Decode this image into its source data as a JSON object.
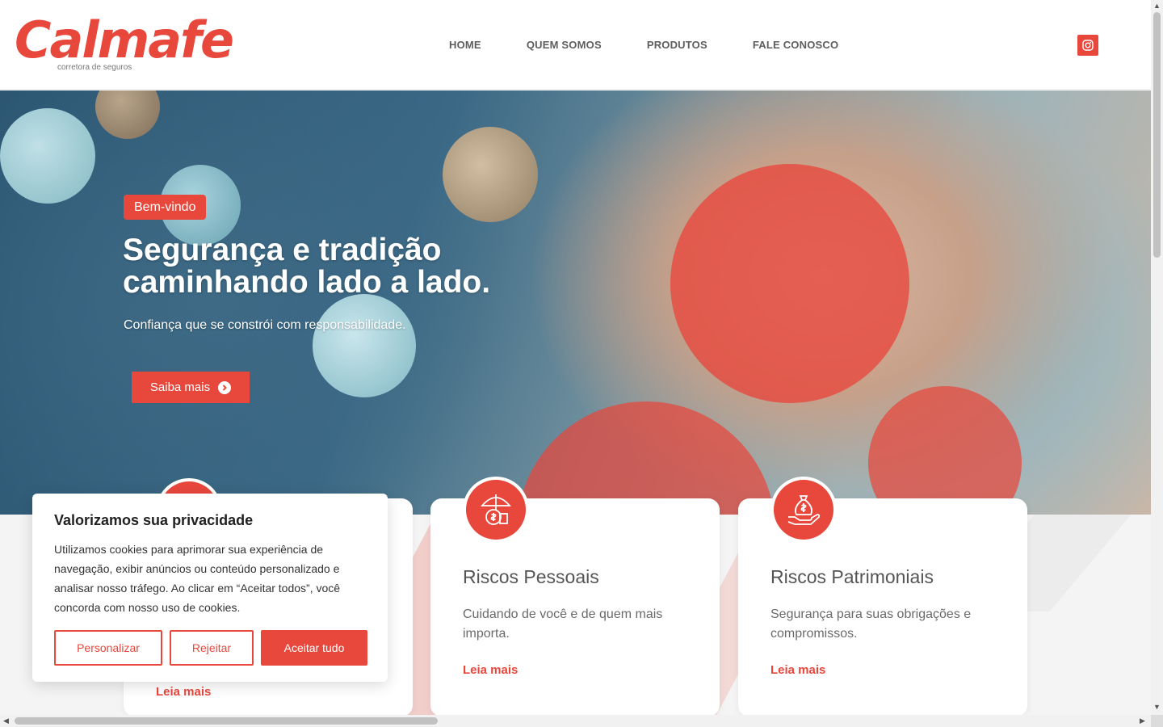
{
  "header": {
    "logo_text": "Calmafe",
    "logo_sub": "corretora de seguros",
    "nav": [
      "HOME",
      "QUEM SOMOS",
      "PRODUTOS",
      "FALE CONOSCO"
    ],
    "social_icon": "instagram-icon"
  },
  "hero": {
    "badge": "Bem-vindo",
    "title": "Segurança e tradição caminhando lado a lado.",
    "subtitle": "Confiança que se constrói com responsabilidade.",
    "cta": "Saiba mais"
  },
  "cards": [
    {
      "title": "Riscos Pessoais",
      "text": "Cuidando de você e de quem mais importa.",
      "link": "Leia mais",
      "icon": "umbrella-money-icon"
    },
    {
      "title": "Riscos Patrimoniais",
      "text": "Segurança para suas obrigações e compromissos.",
      "link": "Leia mais",
      "icon": "money-bag-hand-icon"
    }
  ],
  "hidden_card_link": "Leia mais",
  "cookie": {
    "title": "Valorizamos sua privacidade",
    "text": "Utilizamos cookies para aprimorar sua experiência de navegação, exibir anúncios ou conteúdo personalizado e analisar nosso tráfego. Ao clicar em “Aceitar todos”, você concorda com nosso uso de cookies.",
    "buttons": {
      "customize": "Personalizar",
      "reject": "Rejeitar",
      "accept": "Aceitar tudo"
    }
  },
  "colors": {
    "accent": "#e8473c",
    "nav_text": "#5d5d5d"
  }
}
